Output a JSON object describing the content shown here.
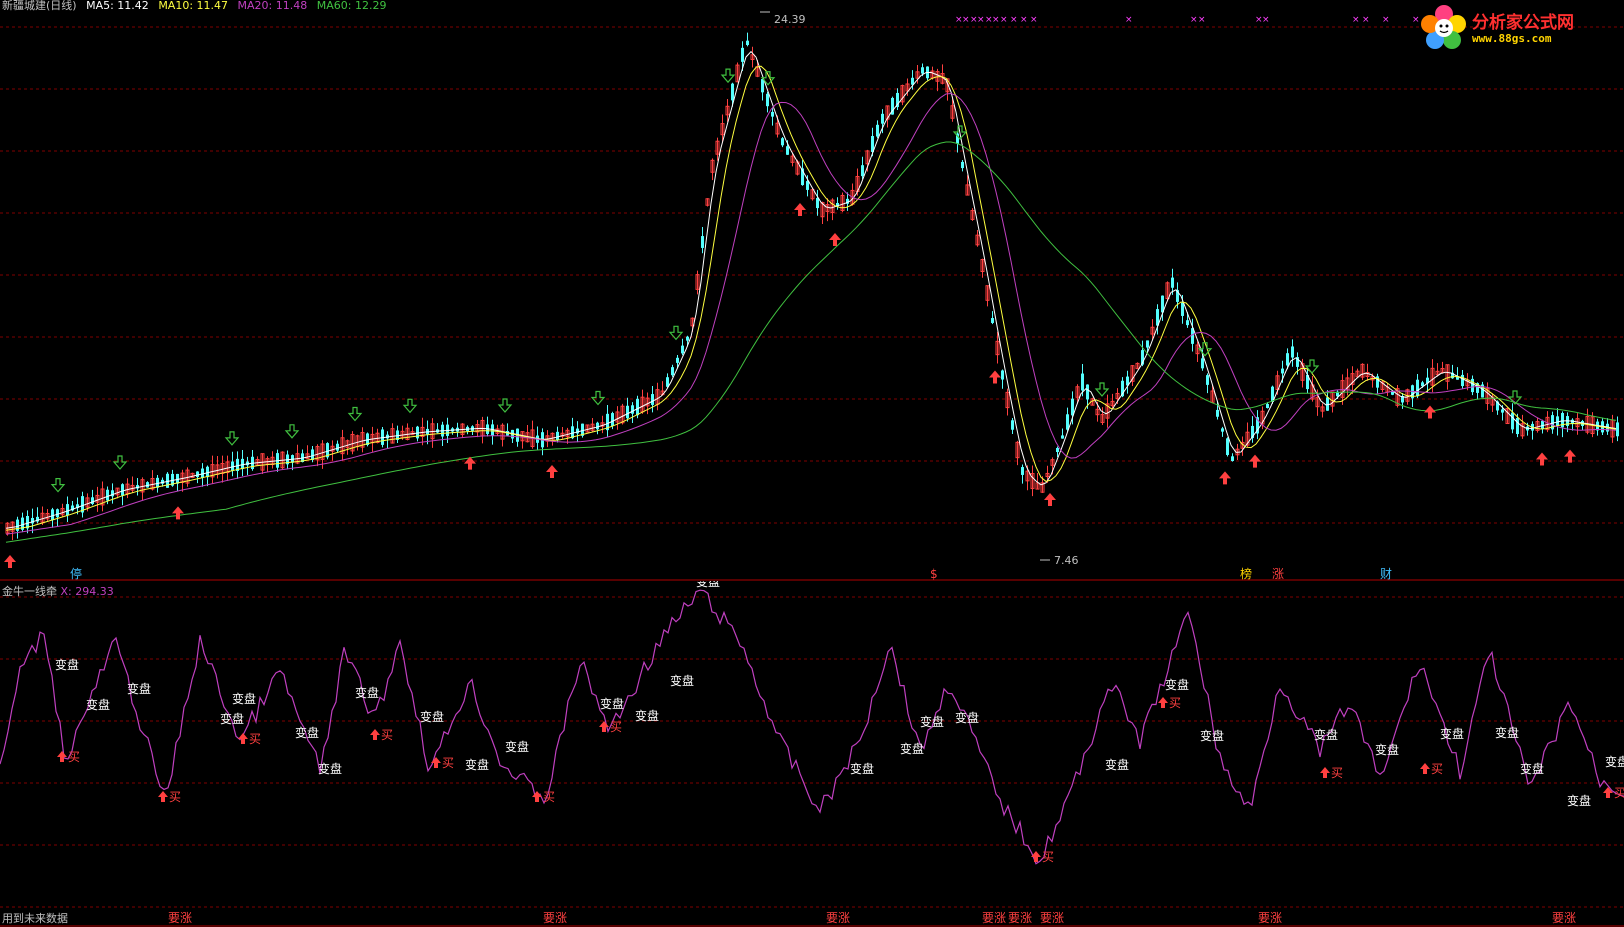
{
  "header": {
    "title": "新疆城建(日线)",
    "ma5": "MA5: 11.42",
    "ma10": "MA10: 11.47",
    "ma20": "MA20: 11.48",
    "ma60": "MA60: 12.29"
  },
  "logo": {
    "name": "分析家公式网",
    "url": "www.88gs.com"
  },
  "price": {
    "high_label": "24.39",
    "low_label": "7.46",
    "events": [
      {
        "label": "停",
        "color": "#40c0ff"
      },
      {
        "label": "$",
        "color": "#ff4040"
      },
      {
        "label": "榜",
        "color": "#ffd400"
      },
      {
        "label": "涨",
        "color": "#ff4040"
      },
      {
        "label": "财",
        "color": "#40c0ff"
      }
    ]
  },
  "oscillator": {
    "title": "金牛一线牵",
    "value_label": "X: 294.33",
    "buy_label": "买",
    "change_label": "变盘",
    "rise_label": "要涨"
  },
  "footer": {
    "note": "用到未来数据"
  },
  "colors": {
    "up": "#ff4040",
    "down": "#54ffff",
    "ma5": "#ffffff",
    "ma10": "#ffff40",
    "ma20": "#c040c0",
    "ma60": "#40c040",
    "osc_line": "#c040c0",
    "grid": "#800000"
  }
}
